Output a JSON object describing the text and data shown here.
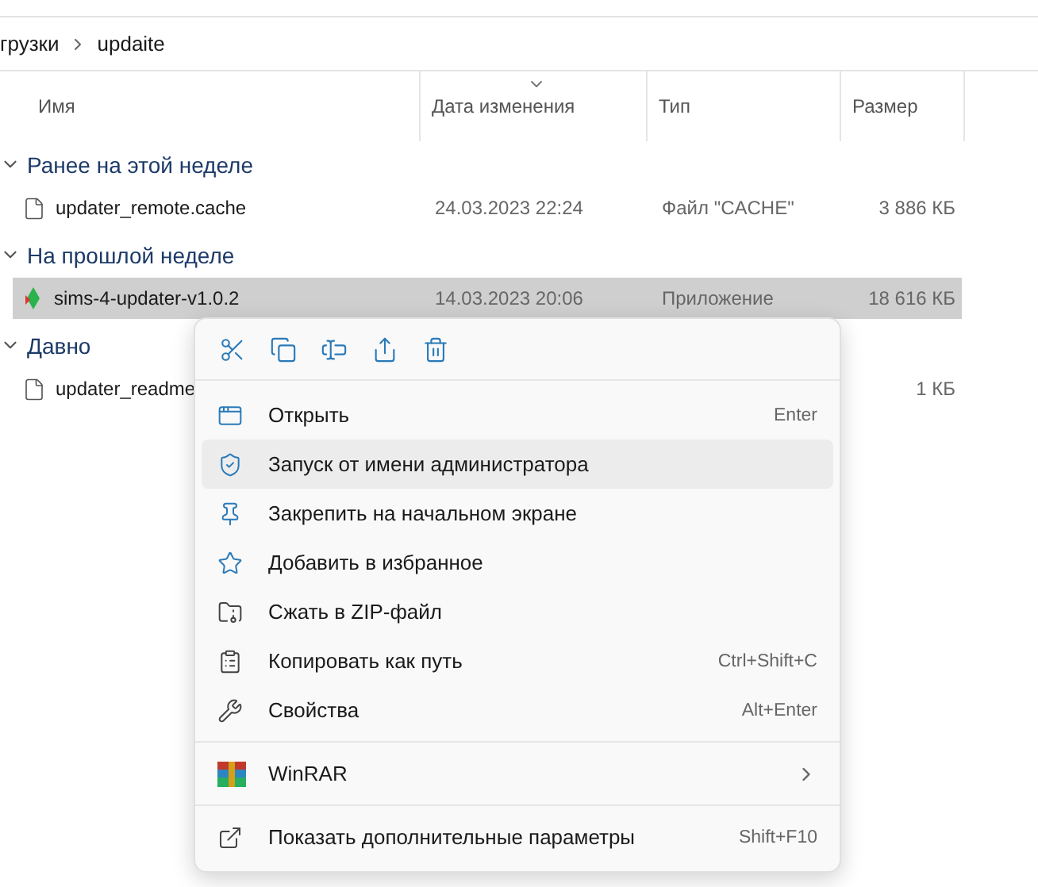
{
  "breadcrumb": [
    "грузки",
    "updaite"
  ],
  "columns": [
    "Имя",
    "Дата изменения",
    "Тип",
    "Размер"
  ],
  "groups": [
    {
      "title": "Ранее на этой неделе",
      "expanded": true,
      "files": [
        {
          "kind": "document",
          "name": "updater_remote.cache",
          "date": "24.03.2023 22:24",
          "type": "Файл \"CACHE\"",
          "size": "3 886 КБ",
          "selected": false
        }
      ]
    },
    {
      "title": "На прошлой неделе",
      "expanded": true,
      "files": [
        {
          "kind": "app",
          "name": "sims-4-updater-v1.0.2",
          "date": "14.03.2023 20:06",
          "type": "Приложение",
          "size": "18 616 КБ",
          "selected": true
        }
      ]
    },
    {
      "title": "Давно",
      "expanded": true,
      "files": [
        {
          "kind": "document",
          "name": "updater_readme",
          "size": "1 КБ",
          "selected": false
        }
      ]
    }
  ],
  "context_menu": {
    "groups": [
      [
        {
          "kind": "item",
          "label": "Открыть",
          "shortcut": "Enter",
          "hovered": false
        },
        {
          "kind": "item",
          "label": "Запуск от имени администратора",
          "hovered": true
        },
        {
          "kind": "item",
          "label": "Закрепить на начальном экране",
          "hovered": false
        },
        {
          "kind": "item",
          "label": "Добавить в избранное",
          "hovered": false
        },
        {
          "kind": "item",
          "label": "Сжать в ZIP-файл",
          "hovered": false
        },
        {
          "kind": "item",
          "label": "Копировать как путь",
          "shortcut": "Ctrl+Shift+C",
          "hovered": false
        },
        {
          "kind": "item",
          "label": "Свойства",
          "shortcut": "Alt+Enter",
          "hovered": false
        }
      ],
      [
        {
          "kind": "submenu",
          "label": "WinRAR",
          "hovered": false
        }
      ],
      [
        {
          "kind": "item",
          "label": "Показать дополнительные параметры",
          "shortcut": "Shift+F10",
          "hovered": false
        }
      ]
    ]
  }
}
